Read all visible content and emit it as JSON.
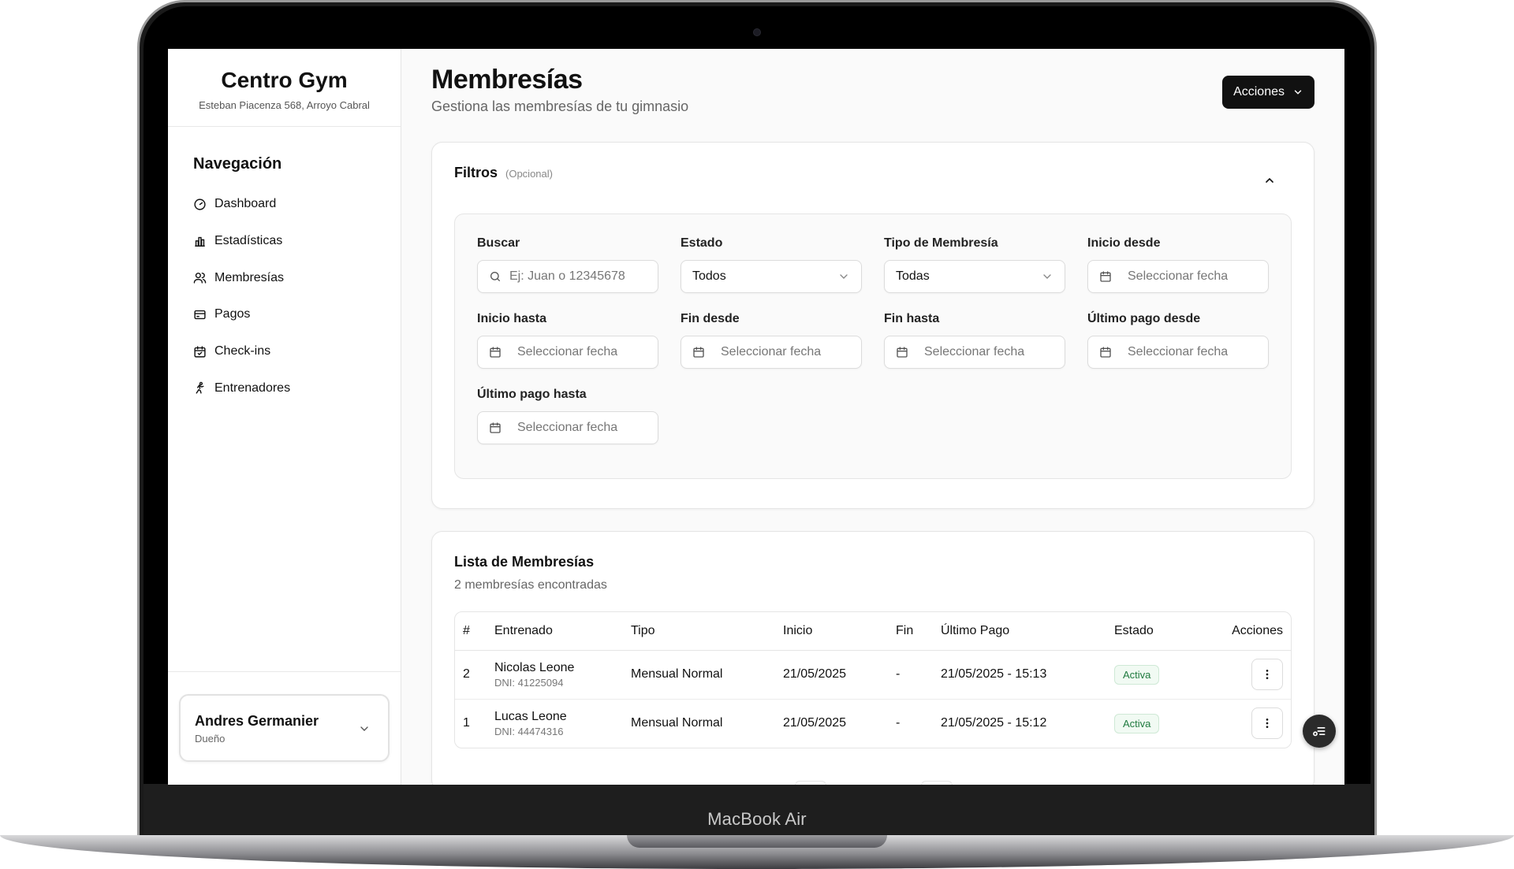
{
  "device_label": "MacBook Air",
  "brand": {
    "name": "Centro Gym",
    "address": "Esteban Piacenza 568, Arroyo Cabral"
  },
  "nav": {
    "title": "Navegación",
    "items": [
      {
        "label": "Dashboard",
        "icon": "gauge-icon"
      },
      {
        "label": "Estadísticas",
        "icon": "bar-chart-icon"
      },
      {
        "label": "Membresías",
        "icon": "users-icon"
      },
      {
        "label": "Pagos",
        "icon": "credit-card-icon"
      },
      {
        "label": "Check-ins",
        "icon": "calendar-check-icon"
      },
      {
        "label": "Entrenadores",
        "icon": "running-icon"
      }
    ]
  },
  "user": {
    "name": "Andres Germanier",
    "role": "Dueño"
  },
  "header": {
    "title": "Membresías",
    "subtitle": "Gestiona las membresías de tu gimnasio",
    "actions_label": "Acciones"
  },
  "filters": {
    "title": "Filtros",
    "optional": "(Opcional)",
    "fields": [
      {
        "label": "Buscar",
        "kind": "search",
        "placeholder": "Ej: Juan o 12345678"
      },
      {
        "label": "Estado",
        "kind": "select",
        "value": "Todos"
      },
      {
        "label": "Tipo de Membresía",
        "kind": "select",
        "value": "Todas"
      },
      {
        "label": "Inicio desde",
        "kind": "date",
        "placeholder": "Seleccionar fecha"
      },
      {
        "label": "Inicio hasta",
        "kind": "date",
        "placeholder": "Seleccionar fecha"
      },
      {
        "label": "Fin desde",
        "kind": "date",
        "placeholder": "Seleccionar fecha"
      },
      {
        "label": "Fin hasta",
        "kind": "date",
        "placeholder": "Seleccionar fecha"
      },
      {
        "label": "Último pago desde",
        "kind": "date",
        "placeholder": "Seleccionar fecha"
      },
      {
        "label": "Último pago hasta",
        "kind": "date",
        "placeholder": "Seleccionar fecha"
      }
    ]
  },
  "list": {
    "title": "Lista de Membresías",
    "subtitle": "2 membresías encontradas",
    "columns": [
      "#",
      "Entrenado",
      "Tipo",
      "Inicio",
      "Fin",
      "Último Pago",
      "Estado",
      "Acciones"
    ],
    "rows": [
      {
        "id": "2",
        "name": "Nicolas Leone",
        "dni": "DNI: 41225094",
        "type": "Mensual Normal",
        "start": "21/05/2025",
        "end": "-",
        "last_payment": "21/05/2025 - 15:13",
        "status": "Activa"
      },
      {
        "id": "1",
        "name": "Lucas Leone",
        "dni": "DNI: 44474316",
        "type": "Mensual Normal",
        "start": "21/05/2025",
        "end": "-",
        "last_payment": "21/05/2025 - 15:12",
        "status": "Activa"
      }
    ]
  },
  "colors": {
    "accent": "#111111",
    "status_active": "#1f7a3f",
    "status_active_bg": "#f1faf3"
  }
}
